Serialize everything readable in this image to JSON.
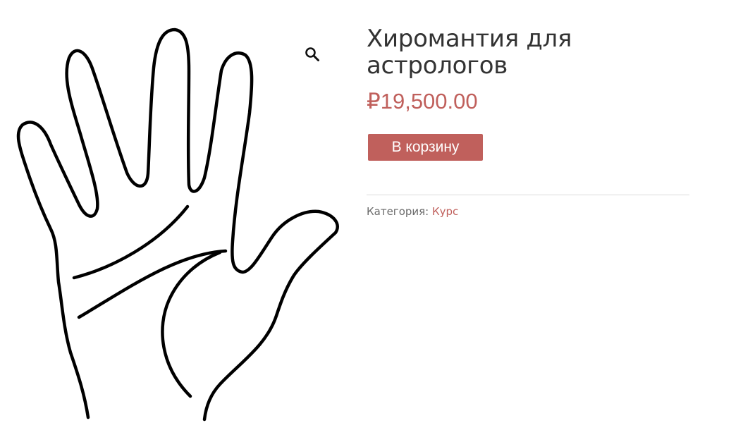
{
  "product": {
    "title": "Хиромантия для астрологов",
    "price": "₽19,500.00",
    "add_to_cart_label": "В корзину",
    "category_label": "Категория: ",
    "category_value": "Курс",
    "image_icon": "palm-hand-drawing",
    "zoom_icon": "magnifier-icon"
  },
  "colors": {
    "accent": "#c0605c",
    "title": "#333333",
    "meta_text": "#6a6a6a",
    "divider": "#dcdcdc"
  }
}
